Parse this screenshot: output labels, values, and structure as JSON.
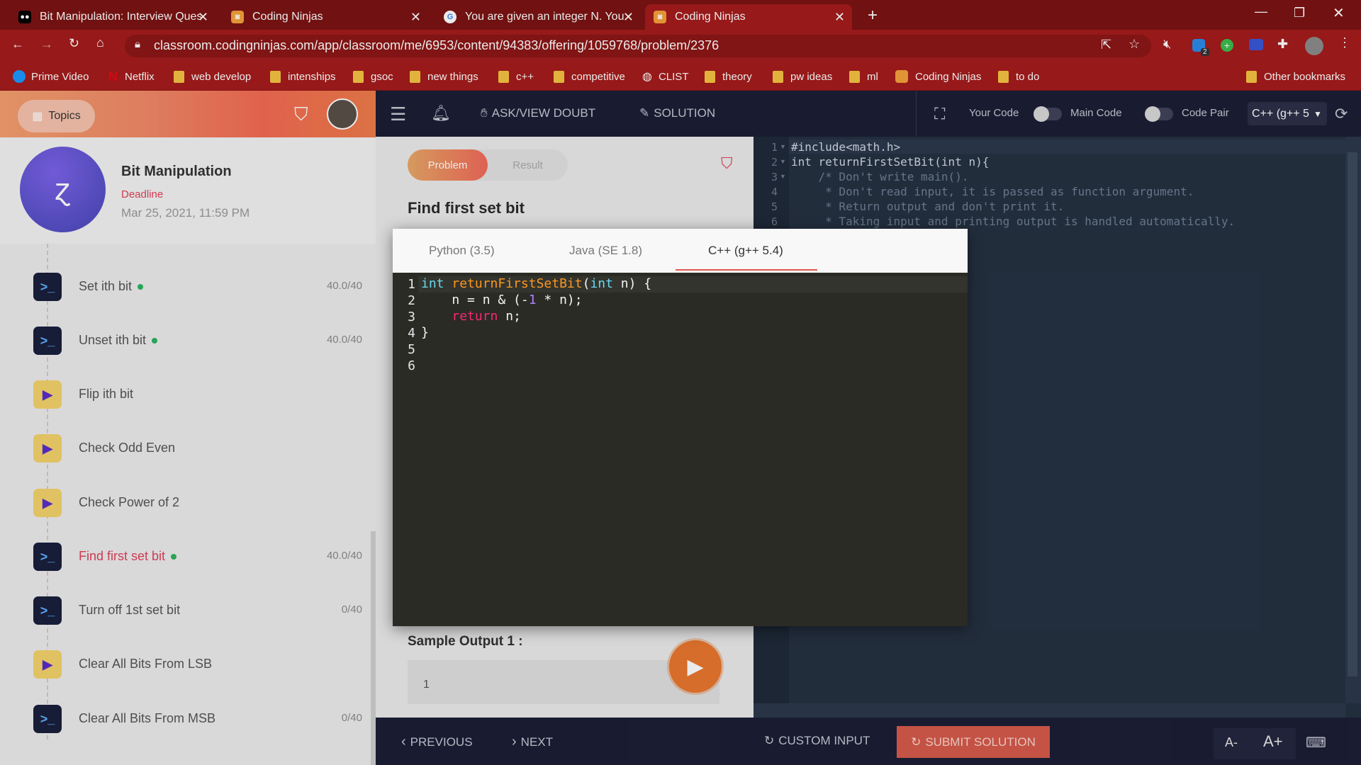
{
  "browser": {
    "tabs": [
      {
        "title": "Bit Manipulation: Interview Ques",
        "favicon": "medium-icon",
        "active": false
      },
      {
        "title": "Coding Ninjas",
        "favicon": "coding-ninjas-icon",
        "active": false
      },
      {
        "title": "You are given an integer N. You m",
        "favicon": "google-icon",
        "active": false
      },
      {
        "title": "Coding Ninjas",
        "favicon": "coding-ninjas-icon",
        "active": true
      }
    ],
    "url": "classroom.codingninjas.com/app/classroom/me/6953/content/94383/offering/1059768/problem/2376",
    "bookmarks": [
      {
        "label": "Prime Video",
        "icon": "prime-video-icon"
      },
      {
        "label": "Netflix",
        "icon": "netflix-icon"
      },
      {
        "label": "web develop",
        "icon": "folder-icon"
      },
      {
        "label": "intenships",
        "icon": "folder-icon"
      },
      {
        "label": "gsoc",
        "icon": "folder-icon"
      },
      {
        "label": "new things",
        "icon": "folder-icon"
      },
      {
        "label": "c++",
        "icon": "folder-icon"
      },
      {
        "label": "competitive",
        "icon": "folder-icon"
      },
      {
        "label": "CLIST",
        "icon": "globe-icon"
      },
      {
        "label": "theory",
        "icon": "folder-icon"
      },
      {
        "label": "pw ideas",
        "icon": "folder-icon"
      },
      {
        "label": "ml",
        "icon": "folder-icon"
      },
      {
        "label": "Coding Ninjas",
        "icon": "coding-ninjas-icon"
      },
      {
        "label": "to do",
        "icon": "folder-icon"
      }
    ],
    "other_bookmarks": "Other bookmarks",
    "extension_badge": "2"
  },
  "sidebar": {
    "topics_label": "Topics",
    "course_title": "Bit Manipulation",
    "deadline_label": "Deadline",
    "deadline_value": "Mar 25, 2021, 11:59 PM",
    "items": [
      {
        "label": "Set ith bit",
        "score": "40.0/40",
        "type": "problem",
        "done": true,
        "active": false
      },
      {
        "label": "Unset ith bit",
        "score": "40.0/40",
        "type": "problem",
        "done": true,
        "active": false
      },
      {
        "label": "Flip ith bit",
        "score": "",
        "type": "video",
        "done": false,
        "active": false
      },
      {
        "label": "Check Odd Even",
        "score": "",
        "type": "video",
        "done": false,
        "active": false
      },
      {
        "label": "Check Power of 2",
        "score": "",
        "type": "video",
        "done": false,
        "active": false
      },
      {
        "label": "Find first set bit",
        "score": "40.0/40",
        "type": "problem",
        "done": true,
        "active": true
      },
      {
        "label": "Turn off 1st set bit",
        "score": "0/40",
        "type": "problem",
        "done": false,
        "active": false
      },
      {
        "label": "Clear All Bits From LSB",
        "score": "",
        "type": "video",
        "done": false,
        "active": false
      },
      {
        "label": "Clear All Bits From MSB",
        "score": "0/40",
        "type": "problem",
        "done": false,
        "active": false
      }
    ]
  },
  "toolbar": {
    "doubt_label": "ASK/VIEW DOUBT",
    "solution_label": "SOLUTION",
    "your_code": "Your Code",
    "main_code": "Main Code",
    "code_pair": "Code Pair",
    "language": "C++ (g++ 5"
  },
  "problem": {
    "tab_problem": "Problem",
    "tab_result": "Result",
    "title": "Find first set bit",
    "sample_output_label": "Sample Output 1 :",
    "sample_output_value": "1"
  },
  "editor": {
    "line_numbers": [
      "1",
      "2",
      "3",
      "4",
      "5",
      "6"
    ],
    "lines": [
      "#include<math.h>",
      "int returnFirstSetBit(int n){",
      "    /* Don't write main().",
      "     * Don't read input, it is passed as function argument.",
      "     * Return output and don't print it.",
      "     * Taking input and printing output is handled automatically."
    ]
  },
  "modal": {
    "tabs": [
      "Python (3.5)",
      "Java (SE 1.8)",
      "C++ (g++ 5.4)"
    ],
    "active_tab": "C++ (g++ 5.4)",
    "line_numbers": [
      "1",
      "2",
      "3",
      "4",
      "5",
      "6"
    ]
  },
  "bottom": {
    "previous": "PREVIOUS",
    "next": "NEXT",
    "custom_input": "CUSTOM INPUT",
    "submit": "SUBMIT SOLUTION",
    "font_decrease": "A-",
    "font_increase": "A+"
  }
}
